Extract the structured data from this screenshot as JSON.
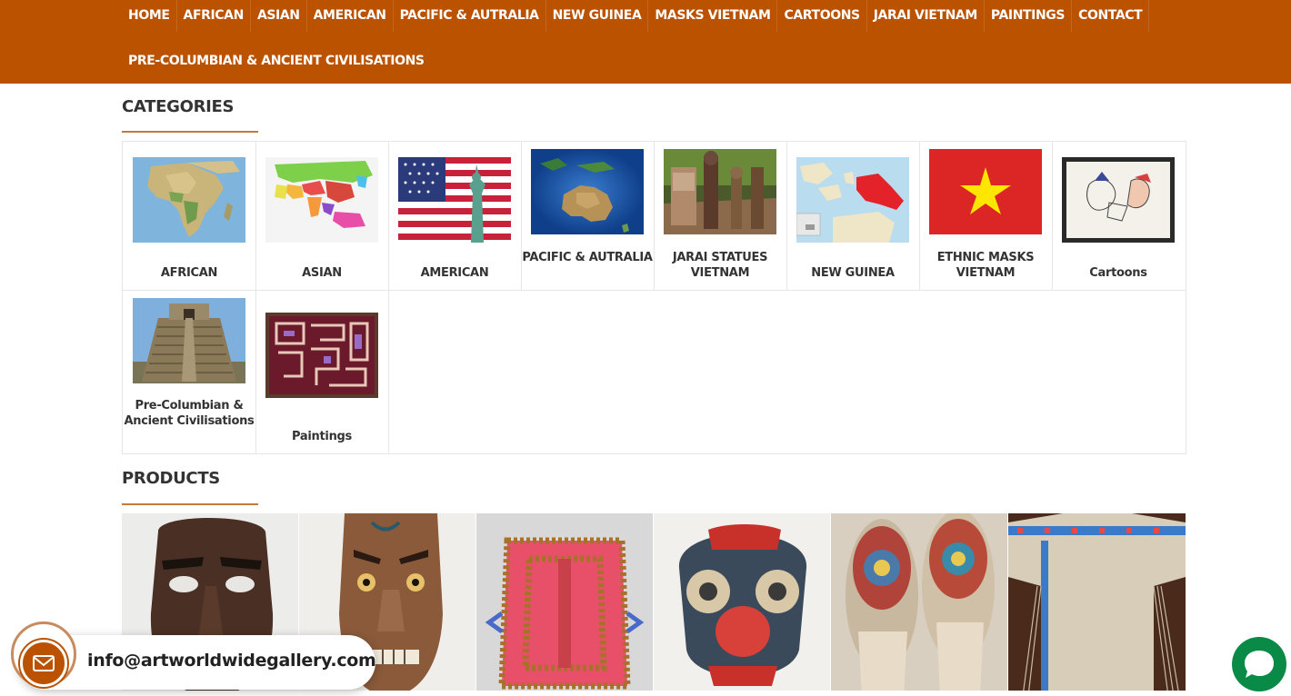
{
  "nav": {
    "row1": [
      "HOME",
      "AFRICAN",
      "ASIAN",
      "AMERICAN",
      "PACIFIC & AUTRALIA",
      "NEW GUINEA",
      "MASKS VIETNAM",
      "CARTOONS",
      "JARAI VIETNAM",
      "PAINTINGS",
      "CONTACT"
    ],
    "row2": [
      "PRE-COLUMBIAN & ANCIENT CIVILISATIONS"
    ]
  },
  "categories": {
    "title": "CATEGORIES",
    "items": [
      {
        "label": "AFRICAN",
        "icon": "africa-map-image"
      },
      {
        "label": "ASIAN",
        "icon": "asia-map-image"
      },
      {
        "label": "AMERICAN",
        "icon": "us-flag-liberty-image"
      },
      {
        "label": "PACIFIC & AUTRALIA",
        "icon": "australia-satellite-image"
      },
      {
        "label": "JARAI STATUES VIETNAM",
        "icon": "jarai-statues-image"
      },
      {
        "label": "NEW GUINEA",
        "icon": "new-guinea-map-image"
      },
      {
        "label": "ETHNIC MASKS VIETNAM",
        "icon": "vietnam-flag-image"
      },
      {
        "label": "Cartoons",
        "icon": "framed-cartoon-image"
      },
      {
        "label": "Pre-Columbian & Ancient Civilisations",
        "icon": "mayan-pyramid-image"
      },
      {
        "label": "Paintings",
        "icon": "mola-textile-image"
      }
    ]
  },
  "products": {
    "title": "PRODUCTS",
    "items": [
      {
        "icon": "dark-wooden-mask-image"
      },
      {
        "icon": "painted-tattoo-mask-image"
      },
      {
        "icon": "beaded-red-textile-image"
      },
      {
        "icon": "red-blue-painted-mask-image"
      },
      {
        "icon": "beaded-moccasins-image"
      },
      {
        "icon": "fringed-buckskin-shirt-image"
      }
    ]
  },
  "contact": {
    "email": "info@artworldwidegallery.com",
    "icon": "envelope-icon"
  },
  "chat": {
    "icon": "chat-bubble-icon"
  },
  "colors": {
    "nav_bg": "#bb5200",
    "accent": "#c57a3a",
    "chat": "#0a8a47"
  }
}
